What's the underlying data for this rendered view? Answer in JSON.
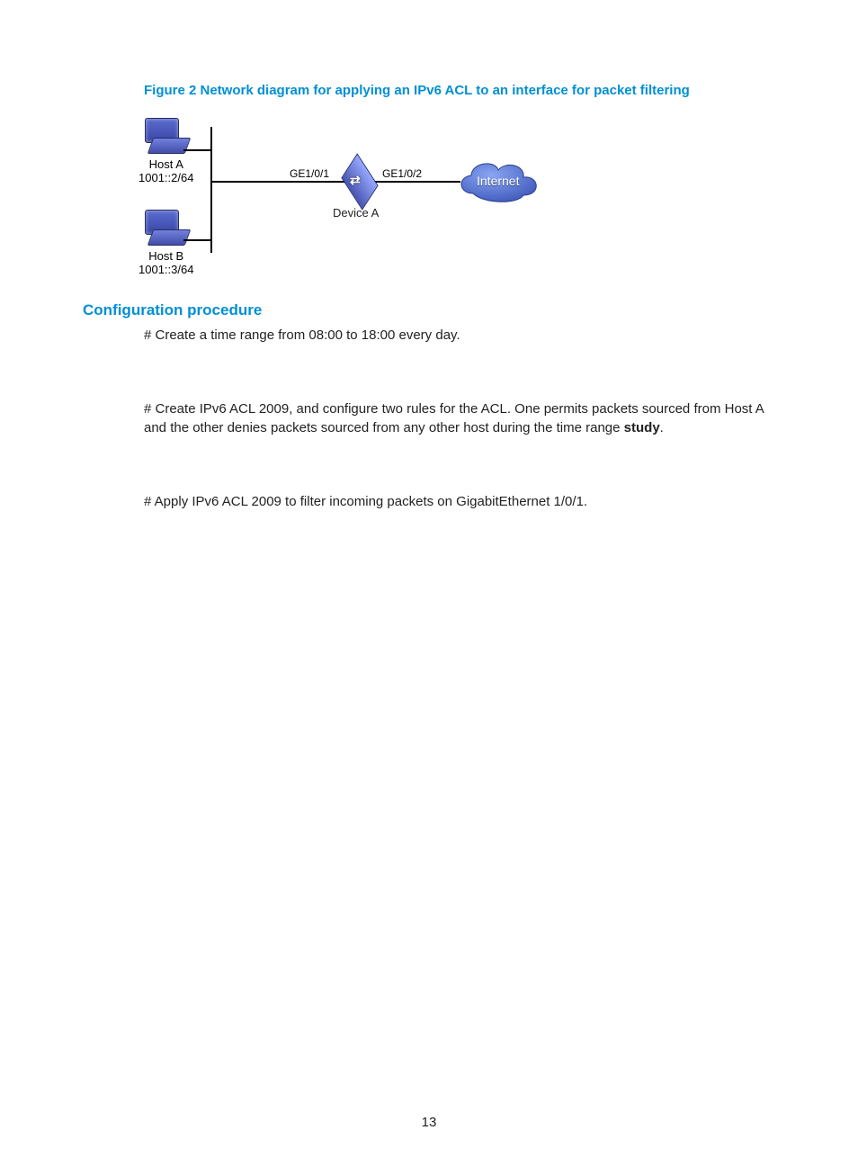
{
  "figure": {
    "caption": "Figure 2 Network diagram for applying an IPv6 ACL to an interface for packet filtering",
    "hostA": {
      "label": "Host A",
      "addr": "1001::2/64"
    },
    "hostB": {
      "label": "Host B",
      "addr": "1001::3/64"
    },
    "port1": "GE1/0/1",
    "port2": "GE1/0/2",
    "deviceA": "Device A",
    "internet": "Internet"
  },
  "headings": {
    "config": "Configuration procedure"
  },
  "paragraphs": {
    "p1": "# Create a time range from 08:00 to 18:00 every day.",
    "p2a": "# Create IPv6 ACL 2009, and configure two rules for the ACL. One permits packets sourced from Host A and the other denies packets sourced from any other host during the time range ",
    "p2bold": "study",
    "p2b": ".",
    "p3": "# Apply IPv6 ACL 2009 to filter incoming packets on GigabitEthernet 1/0/1."
  },
  "page_number": "13"
}
